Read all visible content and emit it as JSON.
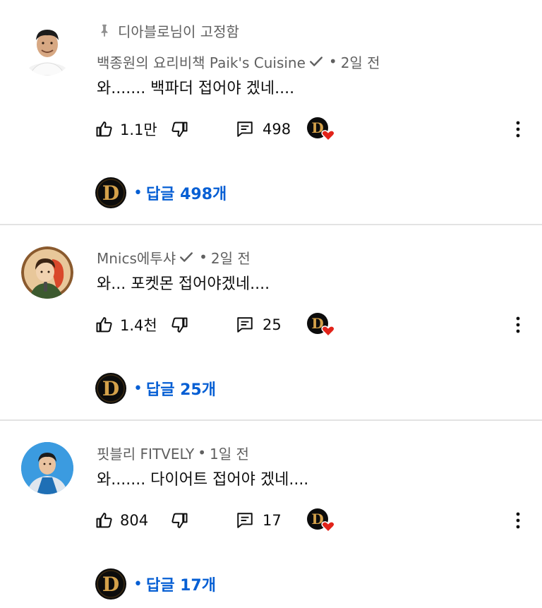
{
  "comments": [
    {
      "pinned_text": "디아블로님이 고정함",
      "author": "백종원의 요리비책 Paik's Cuisine",
      "verified": true,
      "time": "2일 전",
      "text": "와....... 백파더 접어야 겠네....",
      "likes": "1.1만",
      "reply_count": "498",
      "replies_label": "답글 498개",
      "avatar_icon": "chef-portrait-avatar"
    },
    {
      "author": "Mnics에투샤",
      "verified": true,
      "time": "2일 전",
      "text": "와... 포켓몬 접어야겠네....",
      "likes": "1.4천",
      "reply_count": "25",
      "replies_label": "답글 25개",
      "avatar_icon": "illustrated-avatar"
    },
    {
      "author": "핏블리 FITVELY",
      "verified": false,
      "time": "1일 전",
      "text": "와....... 다이어트 접어야 겠네....",
      "likes": "804",
      "reply_count": "17",
      "replies_label": "답글 17개",
      "avatar_icon": "person-photo-avatar"
    }
  ],
  "separator_dot": "•",
  "colors": {
    "link": "#065fd4",
    "secondary_text": "#606060",
    "primary_text": "#0f0f0f",
    "heart": "#e2231a",
    "divider": "#e3e3e3"
  },
  "icons": {
    "like": "thumbs-up-icon",
    "dislike": "thumbs-down-icon",
    "reply": "reply-comment-icon",
    "creator_heart": "creator-heart-icon",
    "more": "more-vertical-icon",
    "pin": "pin-icon",
    "verified": "verified-check-icon"
  }
}
